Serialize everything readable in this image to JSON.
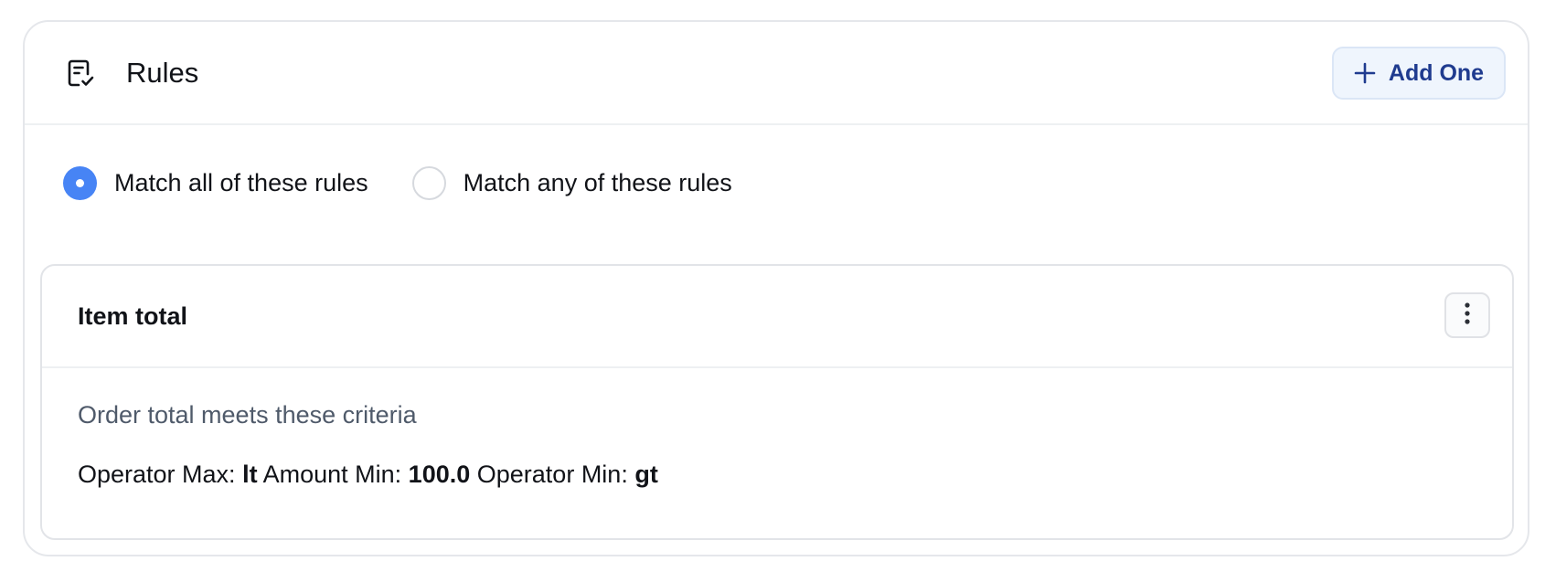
{
  "rules_panel": {
    "title": "Rules",
    "title_icon": "checklist-icon",
    "add_button": {
      "label": "Add One",
      "icon": "plus-icon",
      "accent": "#1f3b8f"
    },
    "match_options": [
      {
        "label": "Match all of these rules",
        "selected": true
      },
      {
        "label": "Match any of these rules",
        "selected": false
      }
    ],
    "selected_color": "#4784f5"
  },
  "rule": {
    "title": "Item total",
    "menu_icon": "more-vertical-icon",
    "criteria": "Order total meets these criteria",
    "details": [
      {
        "label": "Operator Max:",
        "value": "lt"
      },
      {
        "label": "Amount Min:",
        "value": "100.0"
      },
      {
        "label": "Operator Min:",
        "value": "gt"
      }
    ]
  }
}
